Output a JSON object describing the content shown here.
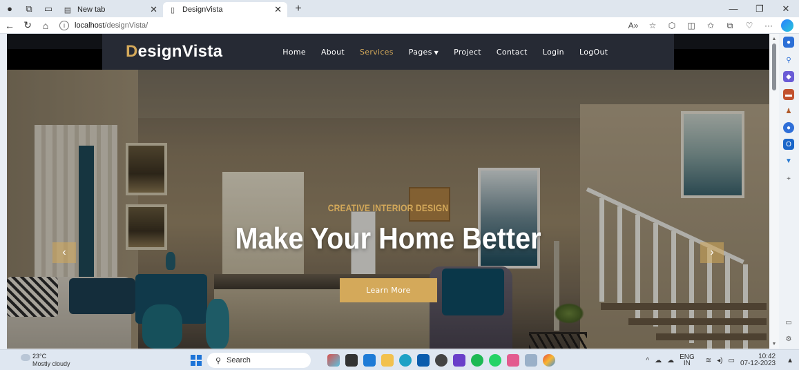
{
  "browser": {
    "tabs": [
      {
        "label": "New tab",
        "active": false
      },
      {
        "label": "DesignVista",
        "active": true
      }
    ],
    "address": {
      "host": "localhost",
      "path": "/designVista/"
    },
    "tools": [
      "read-aloud-icon",
      "favorite-star-icon",
      "extensions-icon",
      "split-screen-icon",
      "favorites-icon",
      "collections-icon",
      "browser-essentials-icon",
      "more-icon",
      "copilot-icon"
    ]
  },
  "site": {
    "brand_first": "D",
    "brand_rest": "esignVista",
    "menu": [
      {
        "label": "Home",
        "active": false
      },
      {
        "label": "About",
        "active": false
      },
      {
        "label": "Services",
        "active": true
      },
      {
        "label": "Pages",
        "active": false,
        "dropdown": true
      },
      {
        "label": "Project",
        "active": false
      },
      {
        "label": "Contact",
        "active": false
      },
      {
        "label": "Login",
        "active": false
      },
      {
        "label": "LogOut",
        "active": false
      }
    ],
    "hero": {
      "kicker": "CREATIVE INTERIOR DESIGN",
      "headline": "Make Your Home Better",
      "cta": "Learn More"
    }
  },
  "taskbar": {
    "weather_temp": "23°C",
    "weather_desc": "Mostly cloudy",
    "search_label": "Search",
    "lang_top": "ENG",
    "lang_bottom": "IN",
    "time": "10:42",
    "date": "07-12-2023"
  },
  "colors": {
    "accent": "#d4a95a",
    "navbar": "#262a34",
    "browser_blue": "#1d74d8"
  }
}
